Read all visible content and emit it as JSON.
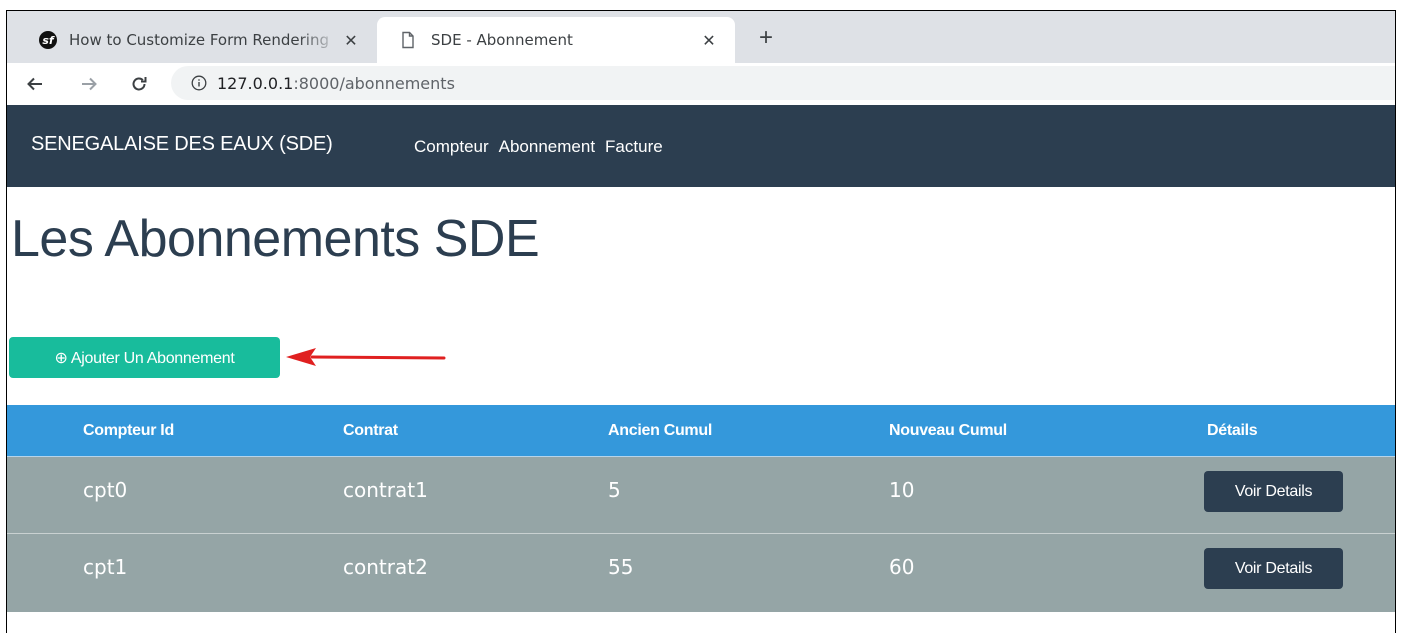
{
  "browser": {
    "tabs": [
      {
        "title": "How to Customize Form Rendering",
        "close": "✕",
        "active": false
      },
      {
        "title": "SDE - Abonnement",
        "close": "✕",
        "active": true
      }
    ],
    "new_tab": "+",
    "url_host": "127.0.0.1",
    "url_rest": ":8000/abonnements"
  },
  "navbar": {
    "brand": "SENEGALAISE DES EAUX (SDE)",
    "links": [
      "Compteur",
      "Abonnement",
      "Facture"
    ]
  },
  "page": {
    "title": "Les Abonnements SDE",
    "add_button": "⊕ Ajouter Un Abonnement",
    "annotation_color": "#e02020"
  },
  "table": {
    "headers": [
      "Compteur Id",
      "Contrat",
      "Ancien Cumul",
      "Nouveau Cumul",
      "Détails"
    ],
    "rows": [
      {
        "compteur_id": "cpt0",
        "contrat": "contrat1",
        "ancien_cumul": "5",
        "nouveau_cumul": "10",
        "action": "Voir Details"
      },
      {
        "compteur_id": "cpt1",
        "contrat": "contrat2",
        "ancien_cumul": "55",
        "nouveau_cumul": "60",
        "action": "Voir Details"
      }
    ]
  },
  "colors": {
    "navbar": "#2c3e50",
    "success": "#18bc9c",
    "table_header": "#3498db",
    "table_row": "#95a5a6"
  }
}
